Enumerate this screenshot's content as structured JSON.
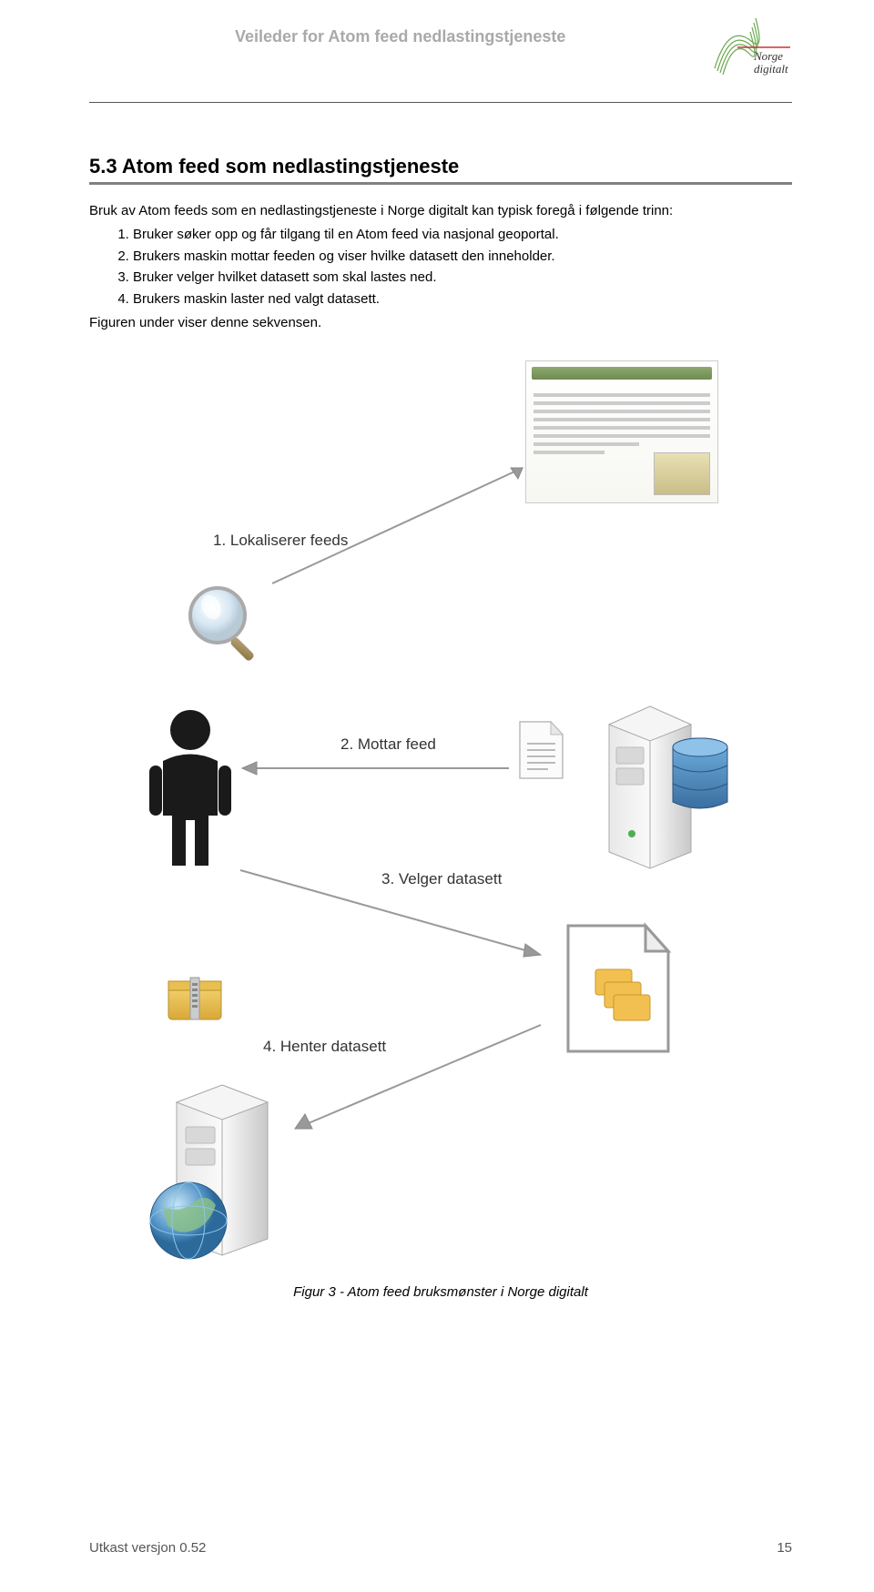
{
  "header": {
    "title": "Veileder for Atom feed nedlastingstjeneste",
    "logo_top": "Norge",
    "logo_bottom": "digitalt"
  },
  "section": {
    "heading": "5.3  Atom feed som nedlastingstjeneste",
    "intro": "Bruk av Atom feeds som en nedlastingstjeneste i Norge digitalt kan typisk foregå i følgende trinn:",
    "steps": [
      "Bruker søker opp og får tilgang til en Atom feed via nasjonal geoportal.",
      "Brukers maskin mottar feeden og viser hvilke datasett den inneholder.",
      "Bruker velger hvilket datasett som skal lastes ned.",
      "Brukers maskin laster ned valgt datasett."
    ],
    "outro": "Figuren under viser denne sekvensen."
  },
  "figure": {
    "labels": {
      "step1": "1. Lokaliserer  feeds",
      "step2": "2. Mottar feed",
      "step3": "3. Velger  datasett",
      "step4": "4. Henter datasett"
    },
    "caption": "Figur 3 - Atom feed bruksmønster i Norge digitalt"
  },
  "footer": {
    "version": "Utkast versjon 0.52",
    "page": "15"
  }
}
